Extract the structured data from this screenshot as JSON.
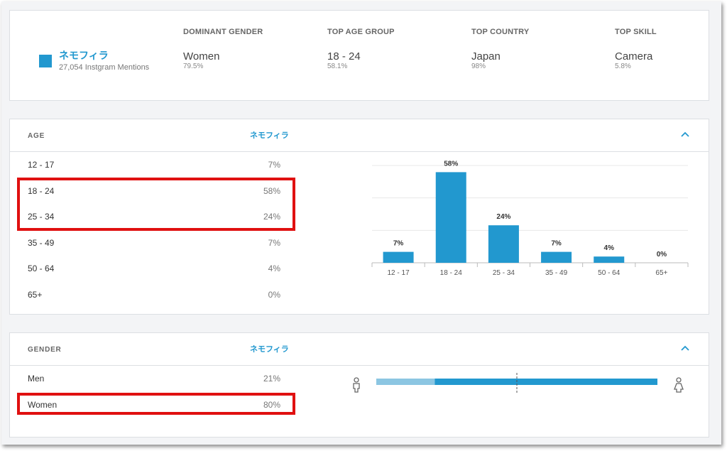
{
  "summary": {
    "brand_name": "ネモフィラ",
    "brand_mentions": "27,054 Instgram Mentions",
    "stats": [
      {
        "label": "DOMINANT GENDER",
        "value": "Women",
        "pct": "79.5%"
      },
      {
        "label": "TOP AGE GROUP",
        "value": "18 - 24",
        "pct": "58.1%"
      },
      {
        "label": "TOP COUNTRY",
        "value": "Japan",
        "pct": "98%"
      },
      {
        "label": "TOP SKILL",
        "value": "Camera",
        "pct": "5.8%"
      }
    ]
  },
  "age": {
    "title": "AGE",
    "brand": "ネモフィラ",
    "rows": [
      {
        "label": "12 - 17",
        "value": "7%"
      },
      {
        "label": "18 - 24",
        "value": "58%"
      },
      {
        "label": "25 - 34",
        "value": "24%"
      },
      {
        "label": "35 - 49",
        "value": "7%"
      },
      {
        "label": "50 - 64",
        "value": "4%"
      },
      {
        "label": "65+",
        "value": "0%"
      }
    ]
  },
  "gender": {
    "title": "GENDER",
    "brand": "ネモフィラ",
    "rows": [
      {
        "label": "Men",
        "value": "21%"
      },
      {
        "label": "Women",
        "value": "80%"
      }
    ]
  },
  "colors": {
    "accent": "#2298cf",
    "men_bar": "#8cc6e2",
    "highlight": "#e01010"
  },
  "chart_data": [
    {
      "type": "bar",
      "categories": [
        "12 - 17",
        "18 - 24",
        "25 - 34",
        "35 - 49",
        "50 - 64",
        "65+"
      ],
      "values": [
        7,
        58,
        24,
        7,
        4,
        0
      ],
      "data_labels": [
        "7%",
        "58%",
        "24%",
        "7%",
        "4%",
        "0%"
      ],
      "ylim": [
        0,
        60
      ],
      "grid": true
    },
    {
      "type": "bar",
      "orientation": "horizontal-stacked",
      "categories": [
        "Men",
        "Women"
      ],
      "values": [
        21,
        80
      ]
    }
  ]
}
